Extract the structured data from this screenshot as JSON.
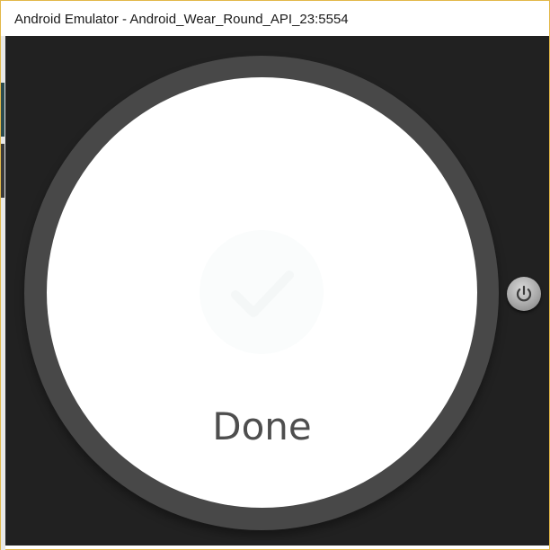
{
  "window": {
    "title": "Android Emulator - Android_Wear_Round_API_23:5554"
  },
  "watch": {
    "confirmation_label": "Done",
    "confirmation_icon": "check-icon"
  },
  "controls": {
    "power_icon": "power-icon"
  },
  "colors": {
    "window_border": "#e2b84a",
    "emulator_background": "#212121",
    "bezel": "#474747",
    "screen": "#ffffff",
    "label": "#4e4e4e"
  }
}
